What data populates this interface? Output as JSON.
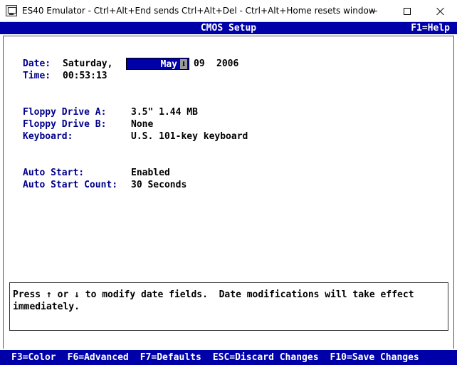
{
  "window": {
    "title": "ES40 Emulator - Ctrl+Alt+End sends Ctrl+Alt+Del - Ctrl+Alt+Home resets window",
    "icon": "monitor-icon"
  },
  "header": {
    "title": "CMOS Setup",
    "help": "F1=Help"
  },
  "fields": {
    "date_label": "Date:",
    "date_weekday": "Saturday,",
    "date_month": "May",
    "date_arrow": "⬇",
    "date_day": "09",
    "date_year": "2006",
    "time_label": "Time:",
    "time_value": "00:53:13",
    "floppy_a_label": "Floppy Drive A:",
    "floppy_a_value": "3.5\" 1.44 MB",
    "floppy_b_label": "Floppy Drive B:",
    "floppy_b_value": "None",
    "keyboard_label": "Keyboard:",
    "keyboard_value": "U.S. 101-key keyboard",
    "auto_start_label": "Auto Start:",
    "auto_start_value": "Enabled",
    "auto_start_count_label": "Auto Start Count:",
    "auto_start_count_value": "30 Seconds"
  },
  "help_box": {
    "text": "Press ↑ or ↓ to modify date fields.  Date modifications will take effect immediately."
  },
  "function_keys": [
    {
      "label": "F3=Color"
    },
    {
      "label": "F6=Advanced"
    },
    {
      "label": "F7=Defaults"
    },
    {
      "label": "ESC=Discard Changes"
    },
    {
      "label": "F10=Save Changes"
    }
  ],
  "colors": {
    "bar_blue": "#0000a8",
    "label_blue": "#00008b",
    "background": "#ffffff"
  }
}
